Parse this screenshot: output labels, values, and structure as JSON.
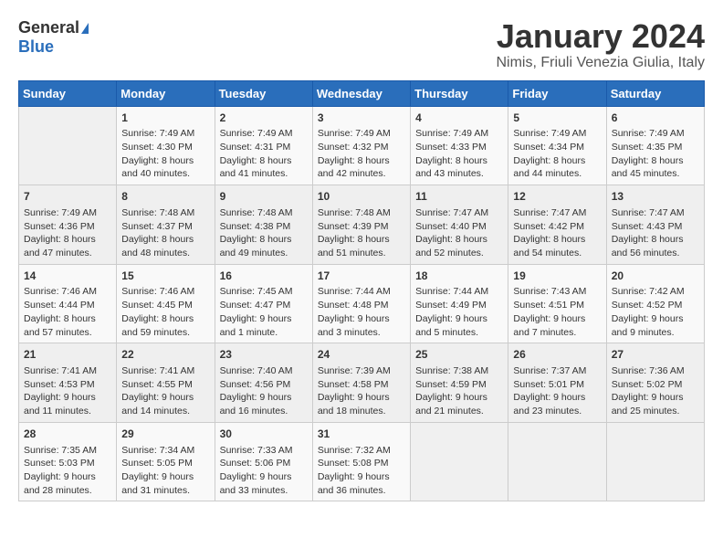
{
  "logo": {
    "general": "General",
    "blue": "Blue"
  },
  "title": "January 2024",
  "subtitle": "Nimis, Friuli Venezia Giulia, Italy",
  "headers": [
    "Sunday",
    "Monday",
    "Tuesday",
    "Wednesday",
    "Thursday",
    "Friday",
    "Saturday"
  ],
  "weeks": [
    [
      {
        "day": "",
        "content": ""
      },
      {
        "day": "1",
        "content": "Sunrise: 7:49 AM\nSunset: 4:30 PM\nDaylight: 8 hours\nand 40 minutes."
      },
      {
        "day": "2",
        "content": "Sunrise: 7:49 AM\nSunset: 4:31 PM\nDaylight: 8 hours\nand 41 minutes."
      },
      {
        "day": "3",
        "content": "Sunrise: 7:49 AM\nSunset: 4:32 PM\nDaylight: 8 hours\nand 42 minutes."
      },
      {
        "day": "4",
        "content": "Sunrise: 7:49 AM\nSunset: 4:33 PM\nDaylight: 8 hours\nand 43 minutes."
      },
      {
        "day": "5",
        "content": "Sunrise: 7:49 AM\nSunset: 4:34 PM\nDaylight: 8 hours\nand 44 minutes."
      },
      {
        "day": "6",
        "content": "Sunrise: 7:49 AM\nSunset: 4:35 PM\nDaylight: 8 hours\nand 45 minutes."
      }
    ],
    [
      {
        "day": "7",
        "content": "Sunrise: 7:49 AM\nSunset: 4:36 PM\nDaylight: 8 hours\nand 47 minutes."
      },
      {
        "day": "8",
        "content": "Sunrise: 7:48 AM\nSunset: 4:37 PM\nDaylight: 8 hours\nand 48 minutes."
      },
      {
        "day": "9",
        "content": "Sunrise: 7:48 AM\nSunset: 4:38 PM\nDaylight: 8 hours\nand 49 minutes."
      },
      {
        "day": "10",
        "content": "Sunrise: 7:48 AM\nSunset: 4:39 PM\nDaylight: 8 hours\nand 51 minutes."
      },
      {
        "day": "11",
        "content": "Sunrise: 7:47 AM\nSunset: 4:40 PM\nDaylight: 8 hours\nand 52 minutes."
      },
      {
        "day": "12",
        "content": "Sunrise: 7:47 AM\nSunset: 4:42 PM\nDaylight: 8 hours\nand 54 minutes."
      },
      {
        "day": "13",
        "content": "Sunrise: 7:47 AM\nSunset: 4:43 PM\nDaylight: 8 hours\nand 56 minutes."
      }
    ],
    [
      {
        "day": "14",
        "content": "Sunrise: 7:46 AM\nSunset: 4:44 PM\nDaylight: 8 hours\nand 57 minutes."
      },
      {
        "day": "15",
        "content": "Sunrise: 7:46 AM\nSunset: 4:45 PM\nDaylight: 8 hours\nand 59 minutes."
      },
      {
        "day": "16",
        "content": "Sunrise: 7:45 AM\nSunset: 4:47 PM\nDaylight: 9 hours\nand 1 minute."
      },
      {
        "day": "17",
        "content": "Sunrise: 7:44 AM\nSunset: 4:48 PM\nDaylight: 9 hours\nand 3 minutes."
      },
      {
        "day": "18",
        "content": "Sunrise: 7:44 AM\nSunset: 4:49 PM\nDaylight: 9 hours\nand 5 minutes."
      },
      {
        "day": "19",
        "content": "Sunrise: 7:43 AM\nSunset: 4:51 PM\nDaylight: 9 hours\nand 7 minutes."
      },
      {
        "day": "20",
        "content": "Sunrise: 7:42 AM\nSunset: 4:52 PM\nDaylight: 9 hours\nand 9 minutes."
      }
    ],
    [
      {
        "day": "21",
        "content": "Sunrise: 7:41 AM\nSunset: 4:53 PM\nDaylight: 9 hours\nand 11 minutes."
      },
      {
        "day": "22",
        "content": "Sunrise: 7:41 AM\nSunset: 4:55 PM\nDaylight: 9 hours\nand 14 minutes."
      },
      {
        "day": "23",
        "content": "Sunrise: 7:40 AM\nSunset: 4:56 PM\nDaylight: 9 hours\nand 16 minutes."
      },
      {
        "day": "24",
        "content": "Sunrise: 7:39 AM\nSunset: 4:58 PM\nDaylight: 9 hours\nand 18 minutes."
      },
      {
        "day": "25",
        "content": "Sunrise: 7:38 AM\nSunset: 4:59 PM\nDaylight: 9 hours\nand 21 minutes."
      },
      {
        "day": "26",
        "content": "Sunrise: 7:37 AM\nSunset: 5:01 PM\nDaylight: 9 hours\nand 23 minutes."
      },
      {
        "day": "27",
        "content": "Sunrise: 7:36 AM\nSunset: 5:02 PM\nDaylight: 9 hours\nand 25 minutes."
      }
    ],
    [
      {
        "day": "28",
        "content": "Sunrise: 7:35 AM\nSunset: 5:03 PM\nDaylight: 9 hours\nand 28 minutes."
      },
      {
        "day": "29",
        "content": "Sunrise: 7:34 AM\nSunset: 5:05 PM\nDaylight: 9 hours\nand 31 minutes."
      },
      {
        "day": "30",
        "content": "Sunrise: 7:33 AM\nSunset: 5:06 PM\nDaylight: 9 hours\nand 33 minutes."
      },
      {
        "day": "31",
        "content": "Sunrise: 7:32 AM\nSunset: 5:08 PM\nDaylight: 9 hours\nand 36 minutes."
      },
      {
        "day": "",
        "content": ""
      },
      {
        "day": "",
        "content": ""
      },
      {
        "day": "",
        "content": ""
      }
    ]
  ]
}
